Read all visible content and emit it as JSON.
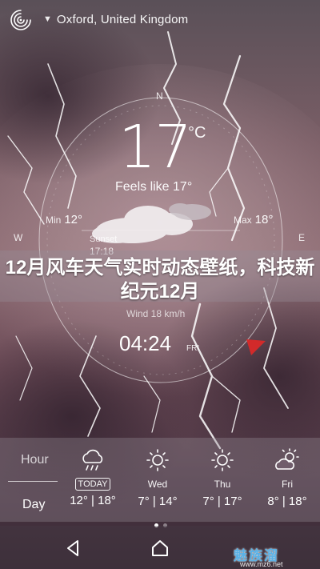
{
  "location": {
    "name": "Oxford, United Kingdom"
  },
  "compass": {
    "n": "N",
    "w": "W",
    "e": "E"
  },
  "current": {
    "temp": "17",
    "unit": "°C",
    "feels_like": "Feels like 17°",
    "min_label": "Min",
    "min_value": "12°",
    "max_label": "Max",
    "max_value": "18°",
    "sunset_label": "Sunset",
    "sunset_time": "17:18",
    "wind": "Wind 18 km/h",
    "clock": "04:24",
    "clock_day": "FRI"
  },
  "banner": {
    "text": "12月风车天气实时动态壁纸，科技新纪元12月"
  },
  "tabs": {
    "hour": "Hour",
    "day": "Day"
  },
  "forecast": [
    {
      "day": "TODAY",
      "temps": "12° | 18°",
      "icon": "cloud-rain-icon"
    },
    {
      "day": "Wed",
      "temps": "7° | 14°",
      "icon": "sun-icon"
    },
    {
      "day": "Thu",
      "temps": "7° | 17°",
      "icon": "sun-icon"
    },
    {
      "day": "Fri",
      "temps": "8° | 18°",
      "icon": "partly-cloudy-icon"
    }
  ],
  "watermark": {
    "brand": "魅族溜",
    "url": "www.mz6.net"
  },
  "colors": {
    "accent_red": "#d22a2a",
    "watermark_blue": "#5ab1e6"
  }
}
